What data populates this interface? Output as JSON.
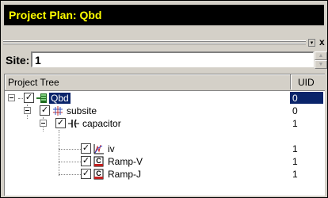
{
  "window": {
    "title": "Project Plan: Qbd"
  },
  "controls": {
    "menu_glyph": "▾",
    "close_glyph": "x"
  },
  "site": {
    "label": "Site:",
    "value": "1"
  },
  "tree": {
    "columns": {
      "tree": "Project Tree",
      "uid": "UID"
    },
    "items": [
      {
        "label": "Qbd",
        "uid": "0",
        "icon": "project-icon",
        "checked": true,
        "selected": true
      },
      {
        "label": "subsite",
        "uid": "0",
        "icon": "subsite-icon",
        "checked": true
      },
      {
        "label": "capacitor",
        "uid": "1",
        "icon": "capacitor-icon",
        "checked": true
      },
      {
        "label": "iv",
        "uid": "1",
        "icon": "iv-plot-icon",
        "checked": true
      },
      {
        "label": "Ramp-V",
        "uid": "1",
        "icon": "c-doc-icon",
        "checked": true
      },
      {
        "label": "Ramp-J",
        "uid": "1",
        "icon": "c-doc-icon",
        "checked": true
      }
    ]
  },
  "colors": {
    "title_bg": "#000000",
    "title_fg": "#ffff00",
    "selection": "#0a246a"
  }
}
